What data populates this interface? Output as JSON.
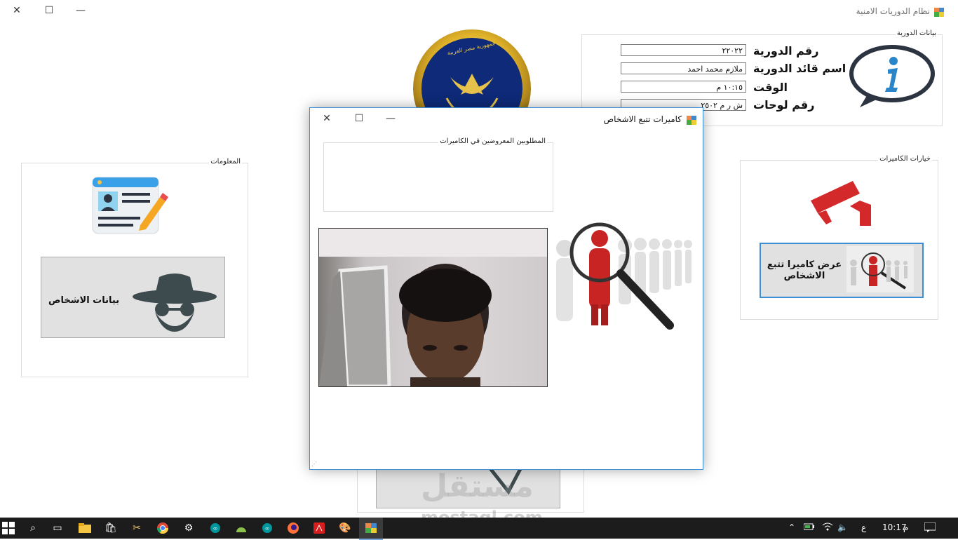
{
  "main_window": {
    "title": "نظام الدوريات الامنية",
    "close_glyph": "✕",
    "maximize_glyph": "☐",
    "minimize_glyph": "—"
  },
  "emblem": {
    "ring_text": "جمهورية مصر العربية",
    "icon": "eagle-emblem-icon"
  },
  "patrol_info": {
    "group_title": "بيانات الدورية",
    "rows": [
      {
        "label": "رقم الدورية",
        "value": "٢٢٠٢٢"
      },
      {
        "label": "اسم قائد الدورية",
        "value": "ملازم محمد احمد"
      },
      {
        "label": "الوقت",
        "value": "١٠:١٥ م"
      },
      {
        "label": "رقم لوحات",
        "value": "ش ر م ٢٥٠٢"
      }
    ],
    "icon": "info-speech-bubble-icon"
  },
  "info_group": {
    "group_title": "المعلومات",
    "card_icon": "id-card-edit-icon",
    "persons_button_label": "بيانات الاشخاص",
    "persons_button_icon": "spy-hat-icon"
  },
  "camera_options": {
    "group_title": "خيارات الكاميرات",
    "camera_icon": "cctv-camera-icon",
    "track_button_label": "عرض كاميرا تتبع الاشخاص",
    "track_button_icon": "person-search-icon"
  },
  "dialog": {
    "title": "كاميرات تتبع الاشخاص",
    "wanted_group_title": "المطلوبين المعروضين في الكاميرات",
    "camera_feed_icon": "camera-feed-image",
    "side_icon": "person-search-magnifier-icon"
  },
  "watermark": {
    "text_ar": "مستقل",
    "text_en": "mostaql.com"
  },
  "taskbar": {
    "time": "10:17",
    "time_suffix": "م",
    "lang": "ع",
    "apps": [
      "windows-start-icon",
      "search-icon",
      "task-view-icon",
      "file-explorer-icon",
      "store-icon",
      "tool-icon",
      "chrome-icon",
      "settings-icon",
      "arduino-icon",
      "android-icon",
      "arduino-icon",
      "firefox-icon",
      "acrobat-icon",
      "paint-icon",
      "app-window-icon"
    ]
  },
  "colors": {
    "accent": "#3c8fd6",
    "taskbar": "#1c1c1c",
    "red": "#d3292a"
  }
}
